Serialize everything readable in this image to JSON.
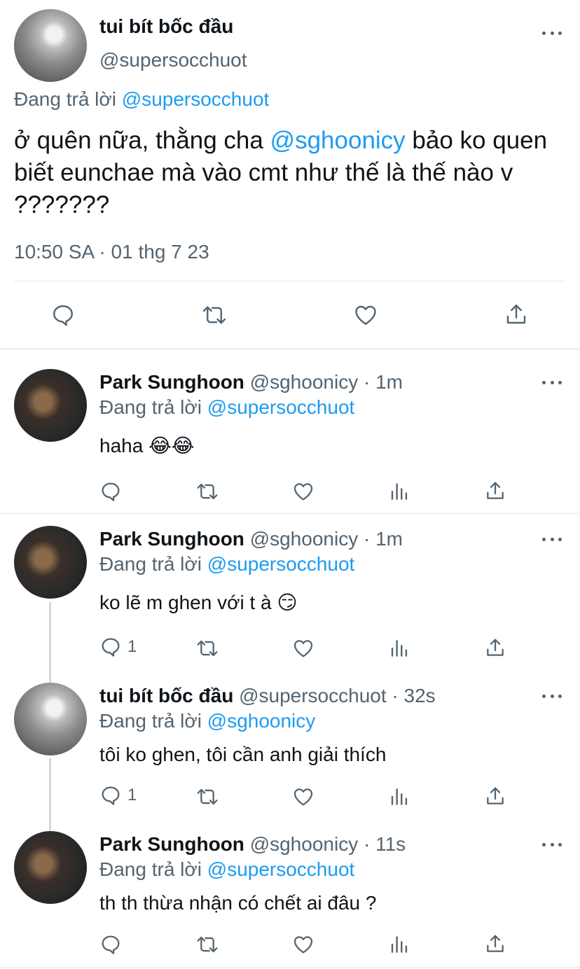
{
  "main_tweet": {
    "display_name": "tui bít bốc đầu",
    "handle": "@supersocchuot",
    "replying_label": "Đang trả lời",
    "replying_to": "@supersocchuot",
    "text_before": "ở quên nữa, thằng cha ",
    "mention": "@sghoonicy",
    "text_after": " bảo ko quen biết eunchae mà vào cmt như thế là thế nào v ???????",
    "timestamp": "10:50 SA · 01 thg 7 23"
  },
  "replies": [
    {
      "display_name": "Park Sunghoon",
      "handle": "@sghoonicy",
      "time": "· 1m",
      "replying_label": "Đang trả lời",
      "replying_to": "@supersocchuot",
      "text": "haha 😂😂",
      "reply_count": ""
    },
    {
      "display_name": "Park Sunghoon",
      "handle": "@sghoonicy",
      "time": "· 1m",
      "replying_label": "Đang trả lời",
      "replying_to": "@supersocchuot",
      "text": "ko lẽ m ghen với t à 😏",
      "reply_count": "1"
    },
    {
      "display_name": "tui bít bốc đầu",
      "handle": "@supersocchuot",
      "time": "· 32s",
      "replying_label": "Đang trả lời",
      "replying_to": "@sghoonicy",
      "text": "tôi ko ghen, tôi cần anh giải thích",
      "reply_count": "1"
    },
    {
      "display_name": "Park Sunghoon",
      "handle": "@sghoonicy",
      "time": "· 11s",
      "replying_label": "Đang trả lời",
      "replying_to": "@supersocchuot",
      "text": "th th thừa nhận có chết ai đâu ?",
      "reply_count": ""
    }
  ],
  "icons": {
    "reply": "comment-icon",
    "retweet": "retweet-icon",
    "like": "heart-icon",
    "analytics": "bar-chart-icon",
    "share": "share-icon",
    "more": "more-icon"
  },
  "colors": {
    "link": "#1d9bf0",
    "secondary": "#536471",
    "text": "#0f1419"
  }
}
